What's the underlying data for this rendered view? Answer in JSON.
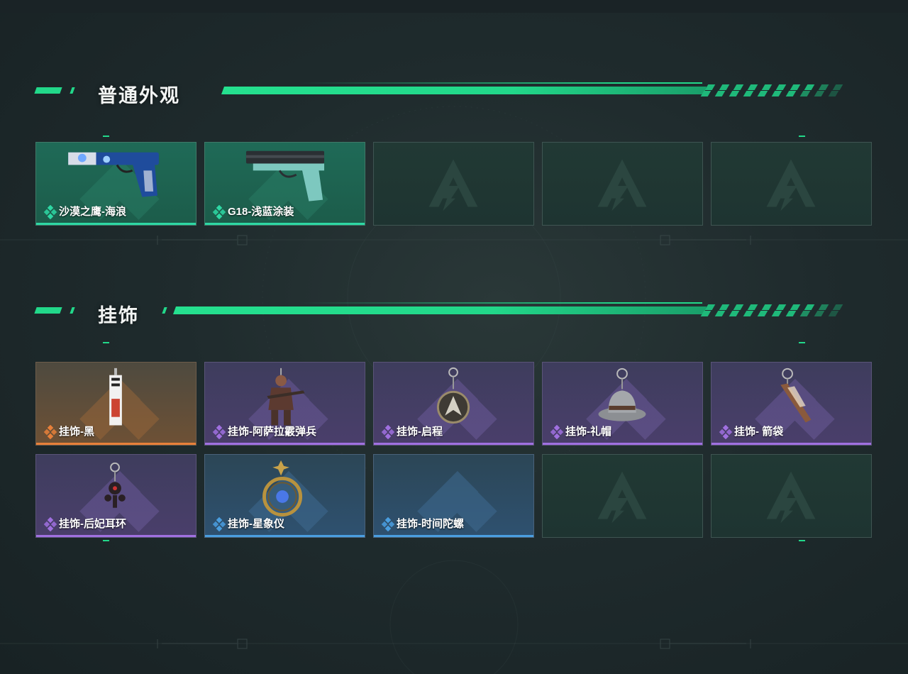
{
  "colors": {
    "accent": "#22d88a",
    "rarity_green": "#2ed8a4",
    "rarity_orange": "#e8803a",
    "rarity_purple": "#a070e0",
    "rarity_blue": "#4a9ee0"
  },
  "sections": [
    {
      "title": "普通外观",
      "rows": [
        [
          {
            "name": "沙漠之鹰-海浪",
            "rarity": "green",
            "icon": "desert-eagle-pistol-icon"
          },
          {
            "name": "G18-浅蓝涂装",
            "rarity": "green",
            "icon": "g18-pistol-icon"
          },
          {
            "empty": true
          },
          {
            "empty": true
          },
          {
            "empty": true
          }
        ]
      ]
    },
    {
      "title": "挂饰",
      "rows": [
        [
          {
            "name": "挂饰-黑",
            "rarity": "orange",
            "icon": "tag-charm-icon"
          },
          {
            "name": "挂饰-阿萨拉霰弹兵",
            "rarity": "purple",
            "icon": "soldier-figure-charm-icon"
          },
          {
            "name": "挂饰-启程",
            "rarity": "purple",
            "icon": "medal-charm-icon"
          },
          {
            "name": "挂饰-礼帽",
            "rarity": "purple",
            "icon": "hat-charm-icon"
          },
          {
            "name": "挂饰- 箭袋",
            "rarity": "purple",
            "icon": "quiver-charm-icon"
          }
        ],
        [
          {
            "name": "挂饰-后妃耳环",
            "rarity": "purple",
            "icon": "earring-charm-icon"
          },
          {
            "name": "挂饰-星象仪",
            "rarity": "blue",
            "icon": "astrolabe-charm-icon"
          },
          {
            "name": "挂饰-时间陀螺",
            "rarity": "blue",
            "icon": "spinning-top-charm-icon"
          },
          {
            "empty": true
          },
          {
            "empty": true
          }
        ]
      ]
    }
  ]
}
